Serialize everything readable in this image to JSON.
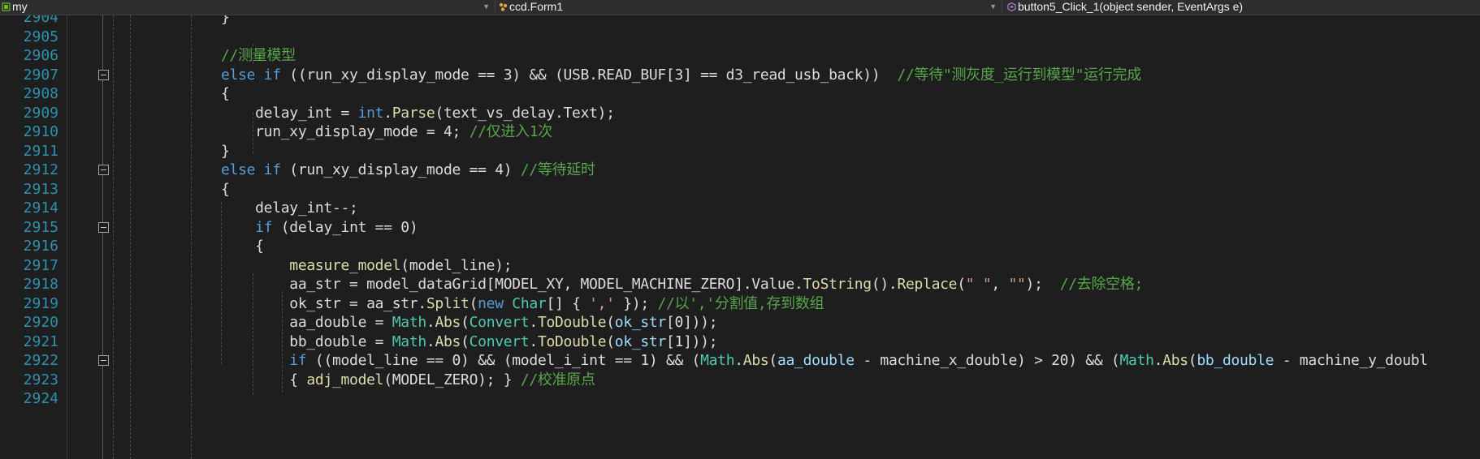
{
  "nav": {
    "project": "my",
    "class": "ccd.Form1",
    "member": "button5_Click_1(object sender, EventArgs e)"
  },
  "lines": [
    {
      "n": "2904",
      "segs": [
        {
          "t": "}",
          "c": "pl"
        }
      ]
    },
    {
      "n": "2905",
      "segs": []
    },
    {
      "n": "2906",
      "segs": [
        {
          "t": "//测量模型",
          "c": "cm"
        }
      ]
    },
    {
      "n": "2907",
      "fold": true,
      "segs": [
        {
          "t": "else if",
          "c": "kw"
        },
        {
          "t": " ((run_xy_display_mode == 3) && (USB.READ_BUF[3] == d3_read_usb_back))  ",
          "c": "pl"
        },
        {
          "t": "//等待\"测灰度_运行到模型\"运行完成",
          "c": "cm"
        }
      ]
    },
    {
      "n": "2908",
      "segs": [
        {
          "t": "{",
          "c": "pl"
        }
      ]
    },
    {
      "n": "2909",
      "segs": [
        {
          "t": "    delay_int = ",
          "c": "pl"
        },
        {
          "t": "int",
          "c": "kw"
        },
        {
          "t": ".",
          "c": "pl"
        },
        {
          "t": "Parse",
          "c": "mt"
        },
        {
          "t": "(text_vs_delay.Text);",
          "c": "pl"
        }
      ]
    },
    {
      "n": "2910",
      "segs": [
        {
          "t": "    run_xy_display_mode = 4; ",
          "c": "pl"
        },
        {
          "t": "//仅进入1次",
          "c": "cm"
        }
      ]
    },
    {
      "n": "2911",
      "segs": [
        {
          "t": "}",
          "c": "pl"
        }
      ]
    },
    {
      "n": "2912",
      "fold": true,
      "segs": [
        {
          "t": "else if",
          "c": "kw"
        },
        {
          "t": " (run_xy_display_mode == 4) ",
          "c": "pl"
        },
        {
          "t": "//等待延时",
          "c": "cm"
        }
      ]
    },
    {
      "n": "2913",
      "segs": [
        {
          "t": "{",
          "c": "pl"
        }
      ]
    },
    {
      "n": "2914",
      "segs": [
        {
          "t": "    delay_int--;",
          "c": "pl"
        }
      ]
    },
    {
      "n": "2915",
      "fold": true,
      "segs": [
        {
          "t": "    ",
          "c": "pl"
        },
        {
          "t": "if",
          "c": "kw"
        },
        {
          "t": " (delay_int == 0)",
          "c": "pl"
        }
      ]
    },
    {
      "n": "2916",
      "segs": [
        {
          "t": "    {",
          "c": "pl"
        }
      ]
    },
    {
      "n": "2917",
      "segs": [
        {
          "t": "        ",
          "c": "pl"
        },
        {
          "t": "measure_model",
          "c": "mt"
        },
        {
          "t": "(model_line);",
          "c": "pl"
        }
      ]
    },
    {
      "n": "2918",
      "segs": [
        {
          "t": "        aa_str = model_dataGrid[MODEL_XY, MODEL_MACHINE_ZERO].Value.",
          "c": "pl"
        },
        {
          "t": "ToString",
          "c": "mt"
        },
        {
          "t": "().",
          "c": "pl"
        },
        {
          "t": "Replace",
          "c": "mt"
        },
        {
          "t": "(",
          "c": "pl"
        },
        {
          "t": "\" \"",
          "c": "st"
        },
        {
          "t": ", ",
          "c": "pl"
        },
        {
          "t": "\"\"",
          "c": "st"
        },
        {
          "t": ");  ",
          "c": "pl"
        },
        {
          "t": "//去除空格;",
          "c": "cm"
        }
      ]
    },
    {
      "n": "2919",
      "segs": [
        {
          "t": "        ok_str = aa_str.",
          "c": "pl"
        },
        {
          "t": "Split",
          "c": "mt"
        },
        {
          "t": "(",
          "c": "pl"
        },
        {
          "t": "new",
          "c": "kw"
        },
        {
          "t": " ",
          "c": "pl"
        },
        {
          "t": "Char",
          "c": "ty"
        },
        {
          "t": "[] { ",
          "c": "pl"
        },
        {
          "t": "','",
          "c": "st"
        },
        {
          "t": " }); ",
          "c": "pl"
        },
        {
          "t": "//以','分割值,存到数组",
          "c": "cm"
        }
      ]
    },
    {
      "n": "2920",
      "segs": [
        {
          "t": "        aa_double = ",
          "c": "pl"
        },
        {
          "t": "Math",
          "c": "ty"
        },
        {
          "t": ".",
          "c": "pl"
        },
        {
          "t": "Abs",
          "c": "mt"
        },
        {
          "t": "(",
          "c": "pl"
        },
        {
          "t": "Convert",
          "c": "ty"
        },
        {
          "t": ".",
          "c": "pl"
        },
        {
          "t": "ToDouble",
          "c": "mt"
        },
        {
          "t": "(",
          "c": "pl"
        },
        {
          "t": "ok_str",
          "c": "vr"
        },
        {
          "t": "[0]));",
          "c": "pl"
        }
      ]
    },
    {
      "n": "2921",
      "segs": [
        {
          "t": "        bb_double = ",
          "c": "pl"
        },
        {
          "t": "Math",
          "c": "ty"
        },
        {
          "t": ".",
          "c": "pl"
        },
        {
          "t": "Abs",
          "c": "mt"
        },
        {
          "t": "(",
          "c": "pl"
        },
        {
          "t": "Convert",
          "c": "ty"
        },
        {
          "t": ".",
          "c": "pl"
        },
        {
          "t": "ToDouble",
          "c": "mt"
        },
        {
          "t": "(",
          "c": "pl"
        },
        {
          "t": "ok_str",
          "c": "vr"
        },
        {
          "t": "[1]));",
          "c": "pl"
        }
      ]
    },
    {
      "n": "2922",
      "fold": true,
      "segs": [
        {
          "t": "        ",
          "c": "pl"
        },
        {
          "t": "if",
          "c": "kw"
        },
        {
          "t": " ((model_line == 0) && (model_i_int == 1) && (",
          "c": "pl"
        },
        {
          "t": "Math",
          "c": "ty"
        },
        {
          "t": ".",
          "c": "pl"
        },
        {
          "t": "Abs",
          "c": "mt"
        },
        {
          "t": "(",
          "c": "pl"
        },
        {
          "t": "aa_double",
          "c": "vr"
        },
        {
          "t": " - machine_x_double) > 20) && (",
          "c": "pl"
        },
        {
          "t": "Math",
          "c": "ty"
        },
        {
          "t": ".",
          "c": "pl"
        },
        {
          "t": "Abs",
          "c": "mt"
        },
        {
          "t": "(",
          "c": "pl"
        },
        {
          "t": "bb_double",
          "c": "vr"
        },
        {
          "t": " - machine_y_doubl",
          "c": "pl"
        }
      ]
    },
    {
      "n": "2923",
      "segs": [
        {
          "t": "        { ",
          "c": "pl"
        },
        {
          "t": "adj_model",
          "c": "mt"
        },
        {
          "t": "(MODEL_ZERO); } ",
          "c": "pl"
        },
        {
          "t": "//校准原点",
          "c": "cm"
        }
      ]
    },
    {
      "n": "2924",
      "segs": []
    }
  ]
}
